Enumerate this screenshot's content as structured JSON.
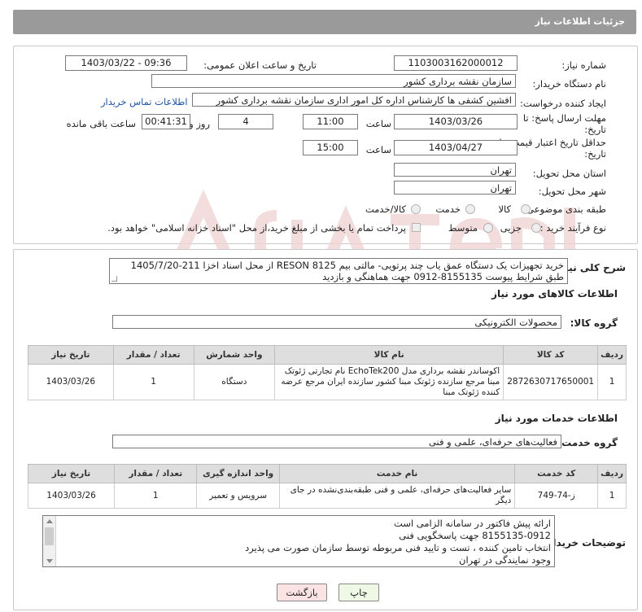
{
  "header": {
    "title": "جزئیات اطلاعات نیاز"
  },
  "fields": {
    "need_number_label": "شماره نیاز:",
    "need_number": "1103003162000012",
    "announce_label": "تاریخ و ساعت اعلان عمومی:",
    "announce_value": "1403/03/22 - 09:36",
    "buyer_label": "نام دستگاه خریدار:",
    "buyer_value": "سازمان نقشه برداری کشور",
    "creator_label": "ایجاد کننده درخواست:",
    "creator_value": "افشین کشفی ها کارشناس اداره کل امور اداری سازمان نقشه برداری کشور",
    "contact_link": "اطلاعات تماس خریدار",
    "deadline_label_1": "مهلت ارسال پاسخ: تا",
    "deadline_label_2": "تاریخ:",
    "deadline_date": "1403/03/26",
    "time_label": "ساعت",
    "deadline_time": "11:00",
    "days_value": "4",
    "days_label": "روز و",
    "remaining_value": "00:41:31",
    "remaining_label": "ساعت باقی مانده",
    "validity_label_1": "حداقل تاریخ اعتبار قیمت: تا",
    "validity_label_2": "تاریخ:",
    "validity_date": "1403/04/27",
    "validity_time": "15:00",
    "province_label": "استان محل تحویل:",
    "province_value": "تهران",
    "city_label": "شهر محل تحویل:",
    "city_value": "تهران",
    "category_label": "طبقه بندی موضوعی:",
    "category_options": [
      "کالا",
      "خدمت",
      "کالا/خدمت"
    ],
    "purchase_label": "نوع فرآیند خرید :",
    "purchase_options": [
      "جزیی",
      "متوسط"
    ],
    "payment_note": "پرداخت تمام یا بخشی از مبلغ خرید،از محل \"اسناد خزانه اسلامی\" خواهد بود."
  },
  "description": {
    "label": "شرح کلی نیاز:",
    "line1": "خرید تجهیزات یک دستگاه عمق یاب چند پرتویی- مالتی بیم RESON 8125 از محل اسناد اخزا 211-1405/7/20",
    "line2": "طبق شرایط پیوست 8155135-0912 جهت هماهنگی و بازدید"
  },
  "goods": {
    "section_title": "اطلاعات کالاهای مورد نیاز",
    "group_label": "گروه کالا:",
    "group_value": "محصولات الکترونیکی",
    "headers": [
      "ردیف",
      "کد کالا",
      "نام کالا",
      "واحد شمارش",
      "تعداد / مقدار",
      "تاریخ نیاز"
    ],
    "rows": [
      {
        "row": "1",
        "code": "2872630717650001",
        "name": "اکوساندر نقشه برداری مدل EchoTek200 نام تجارتی ژئوتک مبنا مرجع سازنده ژئوتک مبنا کشور سازنده ایران مرجع عرضه کننده ژئوتک مبنا",
        "unit": "دستگاه",
        "qty": "1",
        "date": "1403/03/26"
      }
    ]
  },
  "services": {
    "section_title": "اطلاعات خدمات مورد نیاز",
    "group_label": "گروه خدمت:",
    "group_value": "فعالیت‌های حرفه‌ای، علمی و فنی",
    "headers": [
      "ردیف",
      "کد خدمت",
      "نام خدمت",
      "واحد اندازه گیری",
      "تعداد / مقدار",
      "تاریخ نیاز"
    ],
    "rows": [
      {
        "row": "1",
        "code": "ز-74-749",
        "name": "سایر فعالیت‌های حرفه‌ای، علمی و فنی طبقه‌بندی‌نشده در جای دیگر",
        "unit": "سرویس و تعمیر",
        "qty": "1",
        "date": "1403/03/26"
      }
    ]
  },
  "notes": {
    "label": "توضیحات خریدار:",
    "lines": [
      "ارائه پیش فاکتور در سامانه الزامی است",
      "8155135-0912 جهت پاسخگویی فنی",
      "انتخاب تامین کننده ، تست و تایید فنی مربوطه توسط سازمان صورت می پذیرد",
      "وجود نمایندگی در تهران"
    ]
  },
  "buttons": {
    "print": "چاپ",
    "back": "بازگشت"
  },
  "colors": {
    "title_bg": "#9a9a9a",
    "link": "#1a55b5",
    "print_bg": "#eef8e4",
    "back_bg": "#fbe3e3"
  }
}
